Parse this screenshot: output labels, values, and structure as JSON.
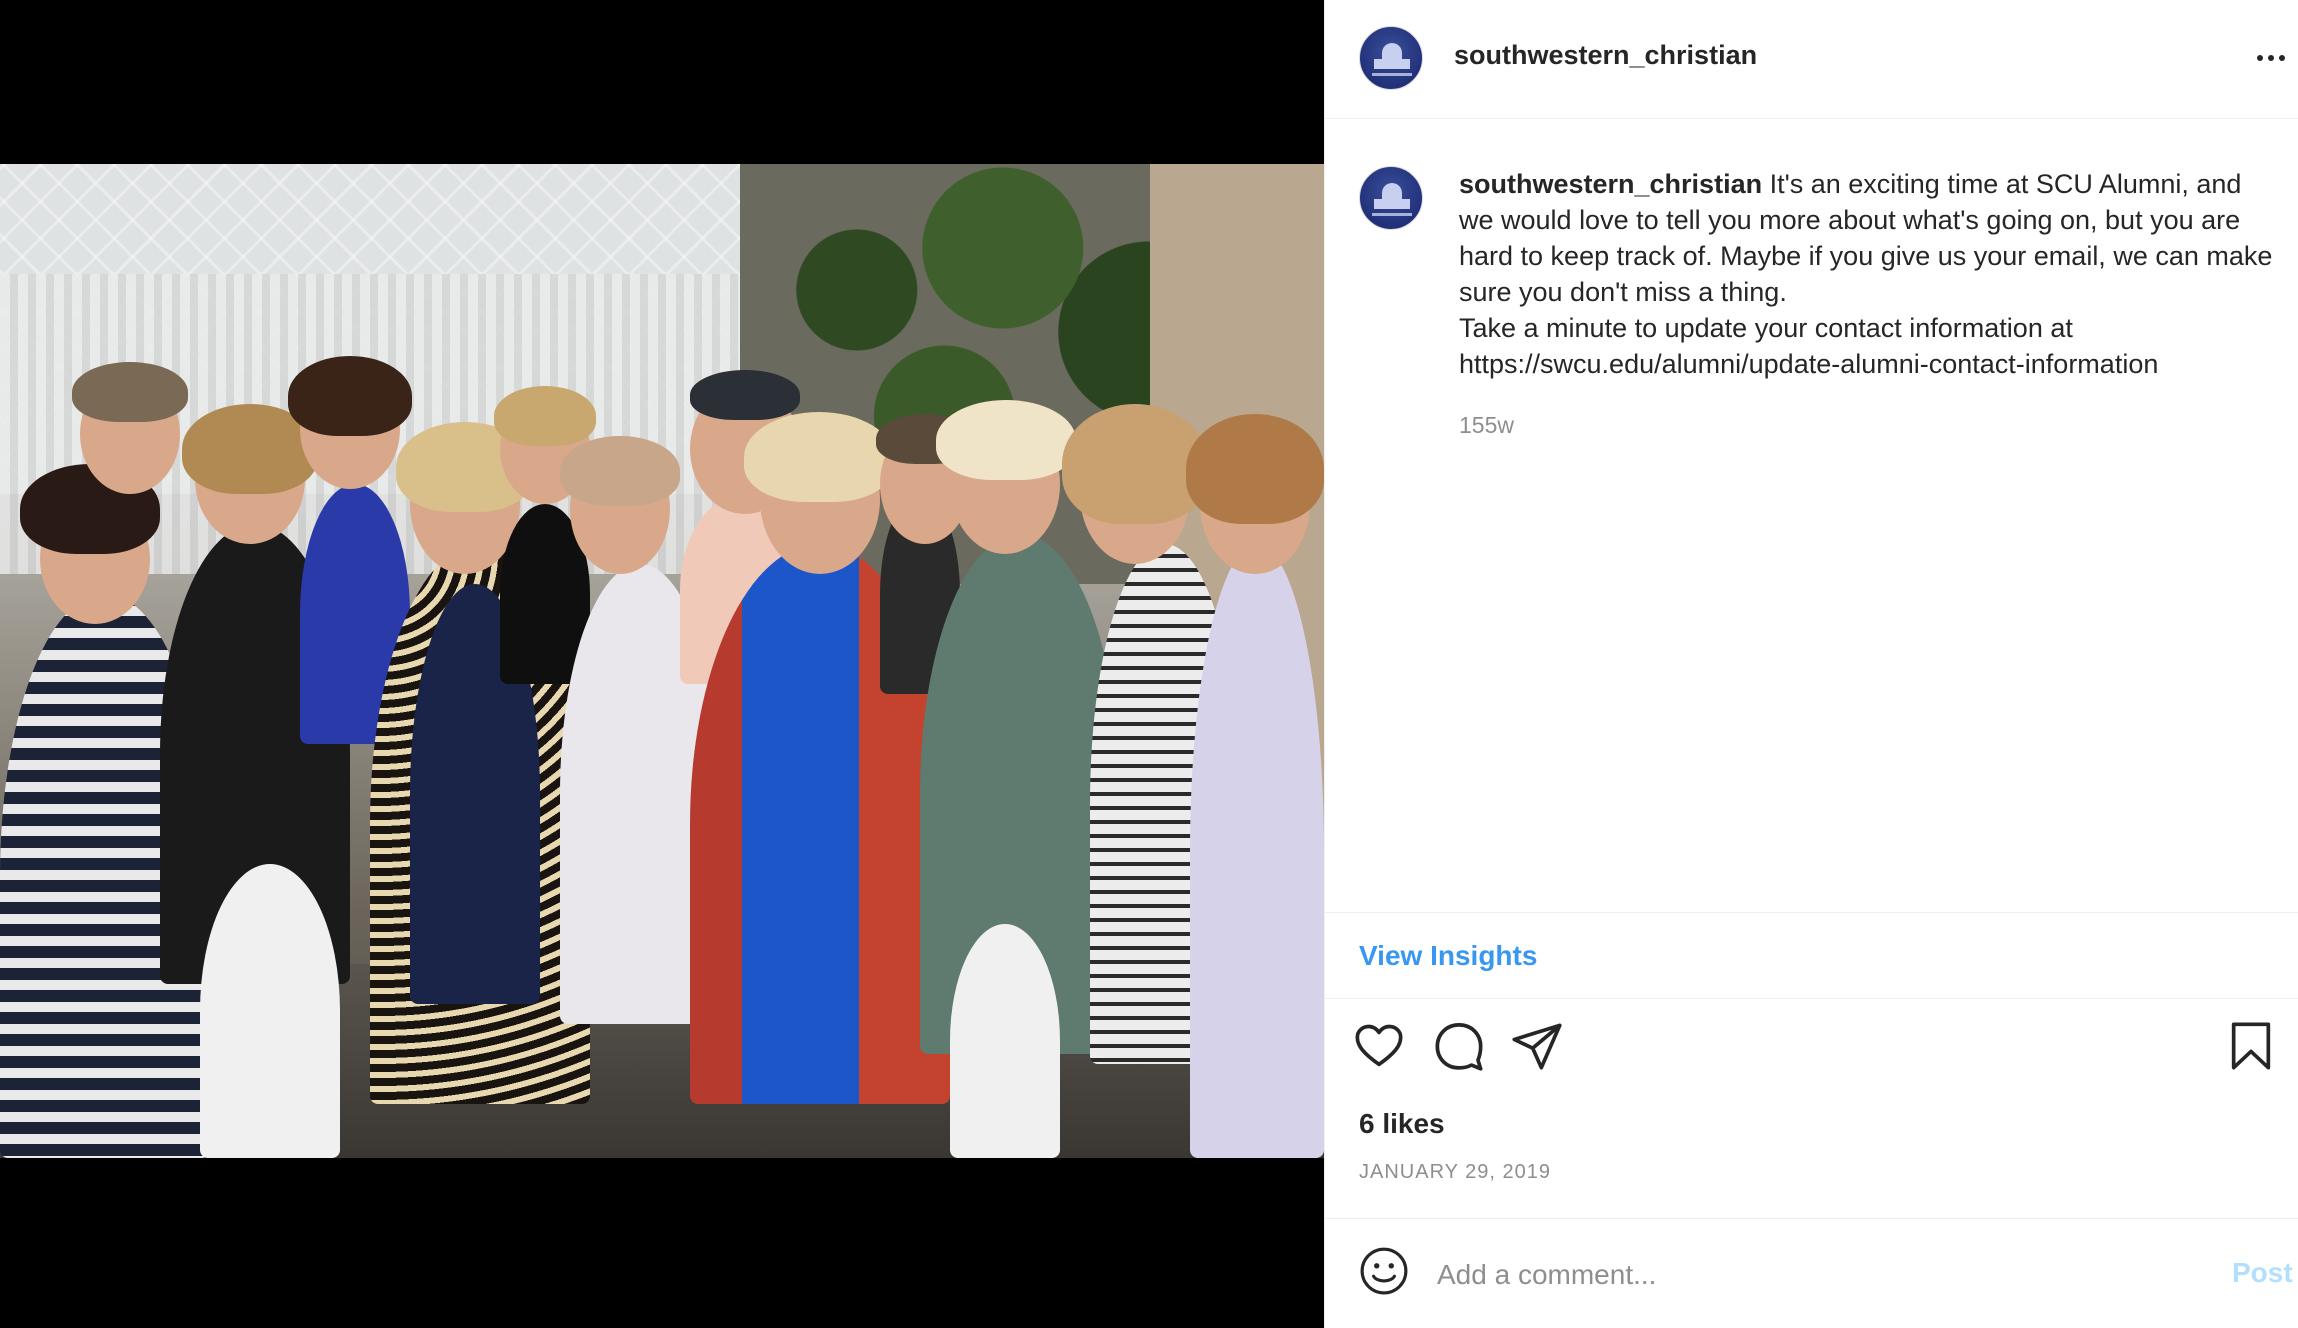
{
  "post": {
    "username": "southwestern_christian",
    "caption_username": "southwestern_christian",
    "caption_text": " It's an exciting time at SCU Alumni, and we would love to tell you more about what's going on, but you are hard to keep track of. Maybe if you give us your email, we can make sure you don't miss a thing.",
    "caption_line2": "Take a minute to update your contact information at https://swcu.edu/alumni/update-alumni-contact-information",
    "time_ago": "155w",
    "view_insights_label": "View Insights",
    "likes": "6 likes",
    "date": "JANUARY 29, 2019"
  },
  "comment": {
    "placeholder": "Add a comment...",
    "post_label": "Post"
  },
  "icons": {
    "like": "heart-icon",
    "comment": "comment-icon",
    "share": "share-icon",
    "save": "bookmark-icon",
    "more": "more-options-icon",
    "emoji": "emoji-icon"
  },
  "colors": {
    "link": "#3897f0",
    "post_disabled": "#b2dffc",
    "muted": "#8e8e8e",
    "text": "#262626"
  }
}
